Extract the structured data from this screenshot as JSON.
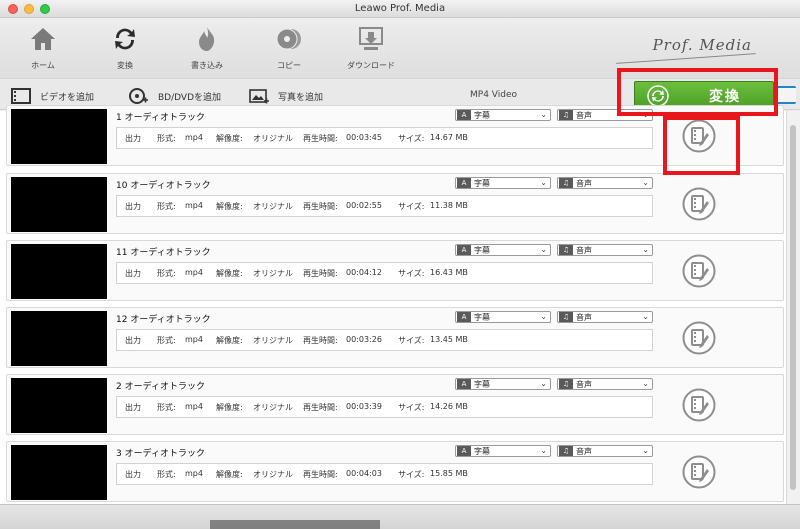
{
  "window": {
    "title": "Leawo Prof. Media"
  },
  "toolbar": {
    "items": [
      {
        "label": "ホーム",
        "icon": "home-icon"
      },
      {
        "label": "変換",
        "icon": "convert-icon"
      },
      {
        "label": "書き込み",
        "icon": "burn-icon"
      },
      {
        "label": "コピー",
        "icon": "copy-disc-icon"
      },
      {
        "label": "ダウンロード",
        "icon": "download-icon"
      }
    ],
    "brand": "Prof. Media"
  },
  "subtoolbar": {
    "add_video": "ビデオを追加",
    "add_bd_dvd": "BD/DVDを追加",
    "add_photo": "写真を追加",
    "format": "MP4 Video"
  },
  "convert_button": {
    "label": "変換",
    "color": "#52a52b"
  },
  "highlight_color": "#e8171c",
  "labels": {
    "output": "出力",
    "format": "形式:",
    "resolution": "解像度:",
    "duration": "再生時間:",
    "size": "サイズ:",
    "subtitle": "字幕",
    "audio": "音声"
  },
  "tracks": [
    {
      "title": "1 オーディオトラック",
      "format": "mp4",
      "resolution": "オリジナル",
      "duration": "00:03:45",
      "size": "14.67 MB"
    },
    {
      "title": "10 オーディオトラック",
      "format": "mp4",
      "resolution": "オリジナル",
      "duration": "00:02:55",
      "size": "11.38 MB"
    },
    {
      "title": "11 オーディオトラック",
      "format": "mp4",
      "resolution": "オリジナル",
      "duration": "00:04:12",
      "size": "16.43 MB"
    },
    {
      "title": "12 オーディオトラック",
      "format": "mp4",
      "resolution": "オリジナル",
      "duration": "00:03:26",
      "size": "13.45 MB"
    },
    {
      "title": "2 オーディオトラック",
      "format": "mp4",
      "resolution": "オリジナル",
      "duration": "00:03:39",
      "size": "14.26 MB"
    },
    {
      "title": "3 オーディオトラック",
      "format": "mp4",
      "resolution": "オリジナル",
      "duration": "00:04:03",
      "size": "15.85 MB"
    }
  ]
}
